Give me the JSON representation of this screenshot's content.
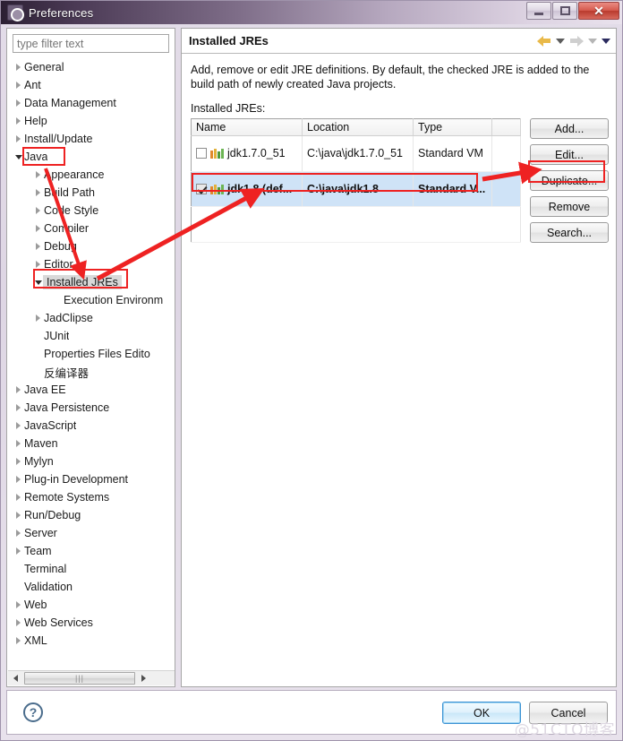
{
  "window": {
    "title": "Preferences",
    "icon": "gear-icon",
    "minimize_label": "",
    "maximize_label": "",
    "close_label": "✕"
  },
  "sidebar": {
    "filter_placeholder": "type filter text",
    "filter_value": "",
    "items": [
      {
        "label": "General",
        "level": 1,
        "expander": "closed",
        "selected": false
      },
      {
        "label": "Ant",
        "level": 1,
        "expander": "closed",
        "selected": false
      },
      {
        "label": "Data Management",
        "level": 1,
        "expander": "closed",
        "selected": false
      },
      {
        "label": "Help",
        "level": 1,
        "expander": "closed",
        "selected": false
      },
      {
        "label": "Install/Update",
        "level": 1,
        "expander": "closed",
        "selected": false
      },
      {
        "label": "Java",
        "level": 1,
        "expander": "open",
        "selected": false
      },
      {
        "label": "Appearance",
        "level": 2,
        "expander": "closed",
        "selected": false
      },
      {
        "label": "Build Path",
        "level": 2,
        "expander": "closed",
        "selected": false
      },
      {
        "label": "Code Style",
        "level": 2,
        "expander": "closed",
        "selected": false
      },
      {
        "label": "Compiler",
        "level": 2,
        "expander": "closed",
        "selected": false
      },
      {
        "label": "Debug",
        "level": 2,
        "expander": "closed",
        "selected": false
      },
      {
        "label": "Editor",
        "level": 2,
        "expander": "closed",
        "selected": false
      },
      {
        "label": "Installed JREs",
        "level": 2,
        "expander": "open",
        "selected": true
      },
      {
        "label": "Execution Environm",
        "level": 3,
        "expander": "none",
        "selected": false
      },
      {
        "label": "JadClipse",
        "level": 2,
        "expander": "closed",
        "selected": false
      },
      {
        "label": "JUnit",
        "level": 2,
        "expander": "none",
        "selected": false
      },
      {
        "label": "Properties Files Edito",
        "level": 2,
        "expander": "none",
        "selected": false
      },
      {
        "label": "反编译器",
        "level": 2,
        "expander": "none",
        "selected": false
      },
      {
        "label": "Java EE",
        "level": 1,
        "expander": "closed",
        "selected": false
      },
      {
        "label": "Java Persistence",
        "level": 1,
        "expander": "closed",
        "selected": false
      },
      {
        "label": "JavaScript",
        "level": 1,
        "expander": "closed",
        "selected": false
      },
      {
        "label": "Maven",
        "level": 1,
        "expander": "closed",
        "selected": false
      },
      {
        "label": "Mylyn",
        "level": 1,
        "expander": "closed",
        "selected": false
      },
      {
        "label": "Plug-in Development",
        "level": 1,
        "expander": "closed",
        "selected": false
      },
      {
        "label": "Remote Systems",
        "level": 1,
        "expander": "closed",
        "selected": false
      },
      {
        "label": "Run/Debug",
        "level": 1,
        "expander": "closed",
        "selected": false
      },
      {
        "label": "Server",
        "level": 1,
        "expander": "closed",
        "selected": false
      },
      {
        "label": "Team",
        "level": 1,
        "expander": "closed",
        "selected": false
      },
      {
        "label": "Terminal",
        "level": 1,
        "expander": "none",
        "selected": false
      },
      {
        "label": "Validation",
        "level": 1,
        "expander": "none",
        "selected": false
      },
      {
        "label": "Web",
        "level": 1,
        "expander": "closed",
        "selected": false
      },
      {
        "label": "Web Services",
        "level": 1,
        "expander": "closed",
        "selected": false
      },
      {
        "label": "XML",
        "level": 1,
        "expander": "closed",
        "selected": false
      }
    ],
    "scrollbar": {
      "left_arrow": "◄",
      "right_arrow": "►",
      "grip": "|||"
    }
  },
  "main": {
    "title": "Installed JREs",
    "nav": {
      "back_icon": "back-arrow-icon",
      "back_menu_icon": "chevron-down-icon",
      "forward_icon": "forward-arrow-icon",
      "forward_menu_icon": "chevron-down-icon",
      "view_menu_icon": "chevron-down-icon"
    },
    "description": "Add, remove or edit JRE definitions. By default, the checked JRE is added to the build path of newly created Java projects.",
    "list_label": "Installed JREs:",
    "table": {
      "columns": [
        "Name",
        "Location",
        "Type",
        ""
      ],
      "rows": [
        {
          "checked": false,
          "selected": false,
          "name": "jdk1.7.0_51",
          "location": "C:\\java\\jdk1.7.0_51",
          "type": "Standard VM"
        },
        {
          "checked": true,
          "selected": true,
          "name": "jdk1.8 (def...",
          "location": "C:\\java\\jdk1.8",
          "type": "Standard V..."
        }
      ]
    },
    "buttons": [
      {
        "label": "Add...",
        "highlighted": false
      },
      {
        "label": "Edit...",
        "highlighted": true
      },
      {
        "label": "Duplicate...",
        "highlighted": false
      },
      {
        "label": "Remove",
        "highlighted": false
      },
      {
        "label": "Search...",
        "highlighted": false
      }
    ]
  },
  "footer": {
    "help_icon": "?",
    "ok_label": "OK",
    "cancel_label": "Cancel",
    "watermark": "@51CTO博客"
  },
  "colors": {
    "annotation": "#ee2222",
    "selection": "#cfe3f7",
    "accent": "#3c93d4"
  }
}
